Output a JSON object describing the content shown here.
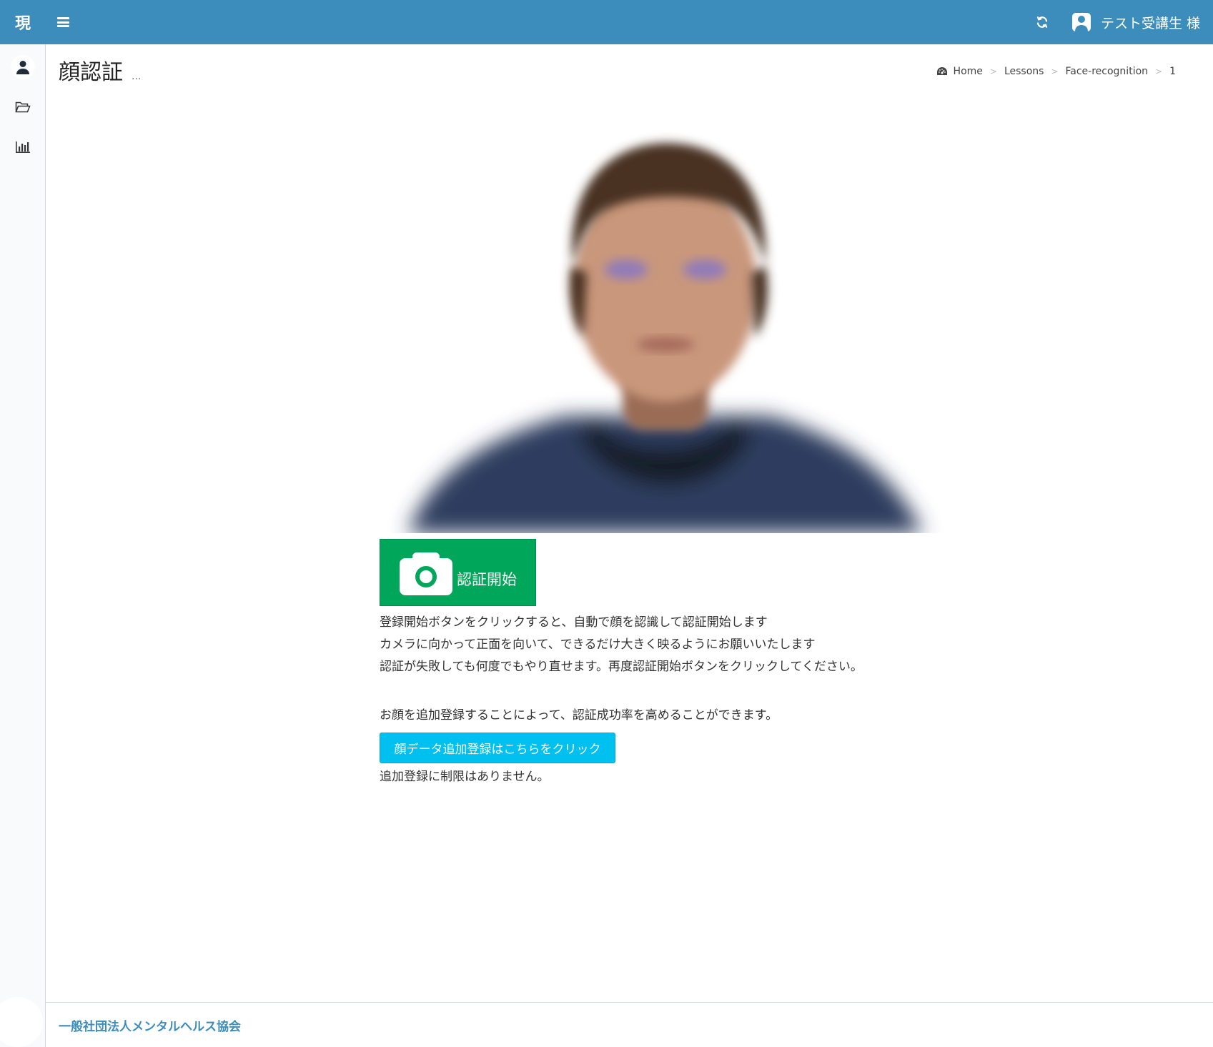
{
  "app": {
    "logo_text": "現"
  },
  "header": {
    "user_name": "テスト受講生 様"
  },
  "sidebar": {
    "items": [
      {
        "name": "user",
        "icon": "user-icon",
        "active": true
      },
      {
        "name": "folder",
        "icon": "folder-open-icon",
        "active": false
      },
      {
        "name": "chart",
        "icon": "bar-chart-icon",
        "active": false
      }
    ]
  },
  "page": {
    "title": "顔認証",
    "subtitle": "..."
  },
  "breadcrumb": {
    "items": [
      "Home",
      "Lessons",
      "Face-recognition",
      "1"
    ]
  },
  "auth": {
    "start_button_label": "認証開始",
    "instructions": [
      "登録開始ボタンをクリックすると、自動で顔を認識して認証開始します",
      "カメラに向かって正面を向いて、できるだけ大きく映るようにお願いいたします",
      "認証が失敗しても何度でもやり直せます。再度認証開始ボタンをクリックしてください。"
    ],
    "extra_text": "お顔を追加登録することによって、認証成功率を高めることができます。",
    "add_face_button_label": "顔データ追加登録はこちらをクリック",
    "no_limit_text": "追加登録に制限はありません。"
  },
  "footer": {
    "org_name": "一般社団法人メンタルヘルス協会"
  },
  "colors": {
    "header_bg": "#3c8dbc",
    "success_green": "#00a65a",
    "info_cyan": "#00c0ef",
    "footer_link": "#3c8dbc"
  }
}
